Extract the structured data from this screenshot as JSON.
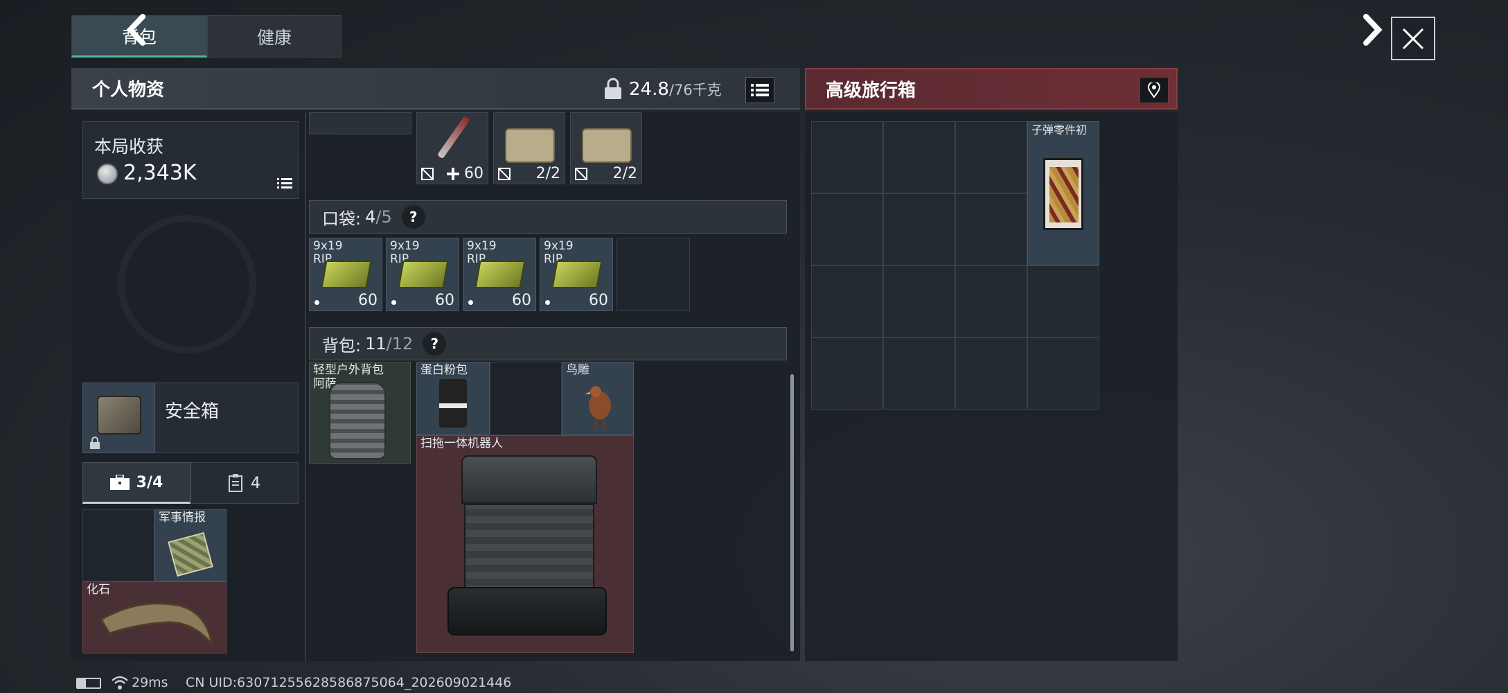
{
  "tabs": {
    "backpack": "背包",
    "health": "健康"
  },
  "left_panel": {
    "title": "个人物资",
    "weight": "24.8",
    "weight_max": "/76千克",
    "session": {
      "title": "本局收获",
      "value": "2,343K"
    },
    "safe_box": "安全箱",
    "sub_tabs": {
      "briefcase": "3/4",
      "clipboard": "4"
    },
    "pouch_items": {
      "intel": "军事情报",
      "fossil": "化石"
    }
  },
  "top_strip": {
    "syringe_count": "60",
    "kit1_count": "2/2",
    "kit2_count": "2/2"
  },
  "pockets": {
    "label": "口袋:",
    "count": "4",
    "max": "/5",
    "help": "?",
    "ammo": [
      {
        "line1": "9x19",
        "line2": "RIP",
        "count": "60"
      },
      {
        "line1": "9x19",
        "line2": "RIP",
        "count": "60"
      },
      {
        "line1": "9x19",
        "line2": "RIP",
        "count": "60"
      },
      {
        "line1": "9x19",
        "line2": "RIP",
        "count": "60"
      }
    ]
  },
  "backpack": {
    "label": "背包:",
    "count": "11",
    "max": "/12",
    "help": "?",
    "items": {
      "bag_line1": "轻型户外背包",
      "bag_line2": "阿萨...",
      "protein": "蛋白粉包",
      "bird": "鸟雕",
      "robot": "扫拖一体机器人"
    }
  },
  "right_panel": {
    "title": "高级旅行箱",
    "bullet_parts": "子弹零件初"
  },
  "status_bar": {
    "ping": "29ms",
    "uid": "CN UID:630712556285868750​64_202609021446"
  },
  "colors": {
    "accent": "#4fb7a0",
    "red_panel": "#6e2f36",
    "blue_slot": "#34414e"
  }
}
